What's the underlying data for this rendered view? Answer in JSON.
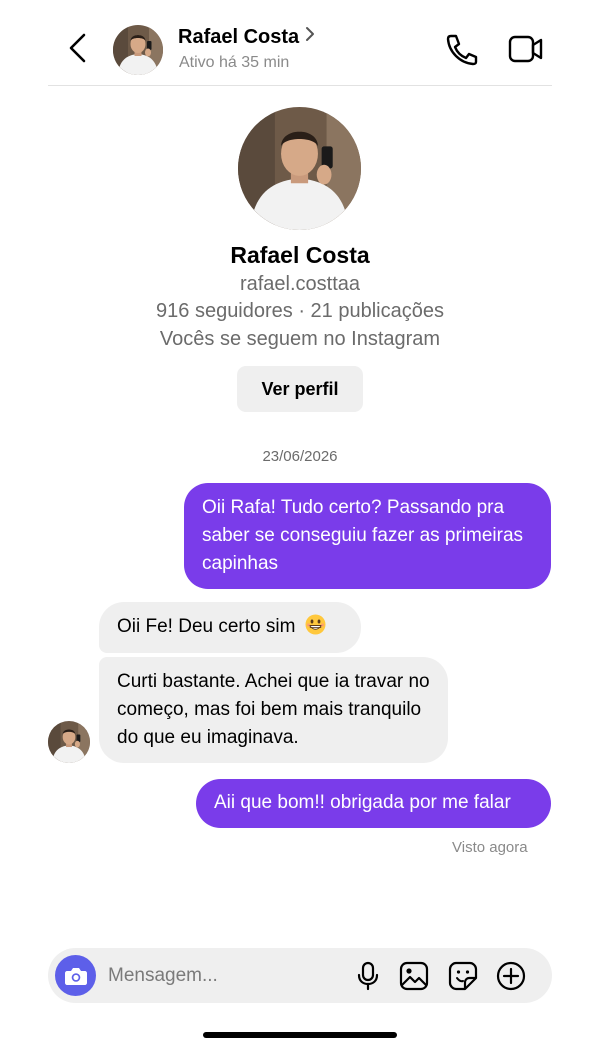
{
  "header": {
    "name": "Rafael Costa",
    "status": "Ativo há 35 min",
    "icons": {
      "back": "back-arrow-icon",
      "call": "phone-icon",
      "video": "video-camera-icon"
    }
  },
  "profile": {
    "name": "Rafael Costa",
    "username": "rafael.costtaa",
    "stats": "916 seguidores · 21 publicações",
    "mutual": "Vocês se seguem no Instagram",
    "view_profile_label": "Ver perfil"
  },
  "conversation": {
    "date": "23/06/2026",
    "messages": [
      {
        "direction": "out",
        "text": "Oii Rafa! Tudo certo? Passando pra saber se conseguiu fazer as primeiras capinhas"
      },
      {
        "direction": "in",
        "text": "Oii Fe! Deu certo sim",
        "emoji": "grinning-face-emoji"
      },
      {
        "direction": "in",
        "text": "Curti bastante. Achei que ia travar no começo, mas foi bem mais tranquilo do que eu imaginava."
      },
      {
        "direction": "out",
        "text": "Aii que bom!! obrigada por me falar"
      }
    ],
    "seen": "Visto agora"
  },
  "composer": {
    "placeholder": "Mensagem...",
    "icons": [
      "camera-icon",
      "microphone-icon",
      "gallery-icon",
      "sticker-icon",
      "plus-icon"
    ]
  },
  "colors": {
    "outgoing_bubble": "#7a3cea",
    "incoming_bubble": "#efefef",
    "camera_button": "#5d5fe9"
  }
}
